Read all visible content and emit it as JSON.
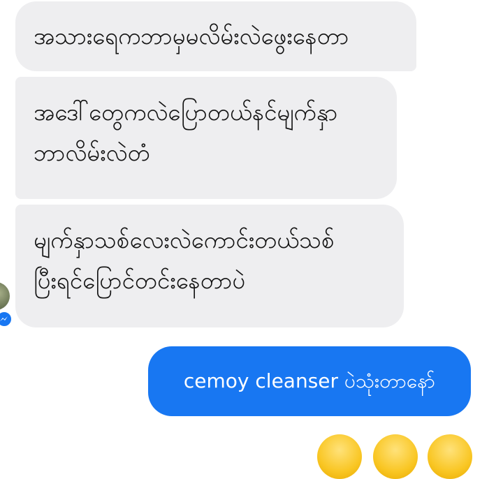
{
  "messages": [
    {
      "direction": "incoming",
      "lines": [
        "အသားရေကဘာမှမလိမ်းလဲဖွေးနေတာ"
      ]
    },
    {
      "direction": "incoming",
      "lines": [
        "အဒေါ်တွေကလဲပြောတယ်နင်မျက်နှာ",
        "ဘာလိမ်းလဲတံ"
      ]
    },
    {
      "direction": "incoming",
      "lines": [
        "မျက်နှာသစ်လေးလဲကောင်းတယ်သစ်",
        "ပြီးရင်ပြောင်တင်းနေတာပဲ"
      ]
    },
    {
      "direction": "outgoing",
      "text": "cemoy cleanser ပဲသုံးတာနော်"
    }
  ],
  "colors": {
    "incoming_bubble": "#eeeef0",
    "outgoing_bubble": "#1877f2",
    "outgoing_text": "#ffffff"
  },
  "icons": {
    "sender_badge": "messenger-badge-icon",
    "reactions": [
      "emoji-icon",
      "emoji-icon",
      "emoji-icon"
    ]
  }
}
